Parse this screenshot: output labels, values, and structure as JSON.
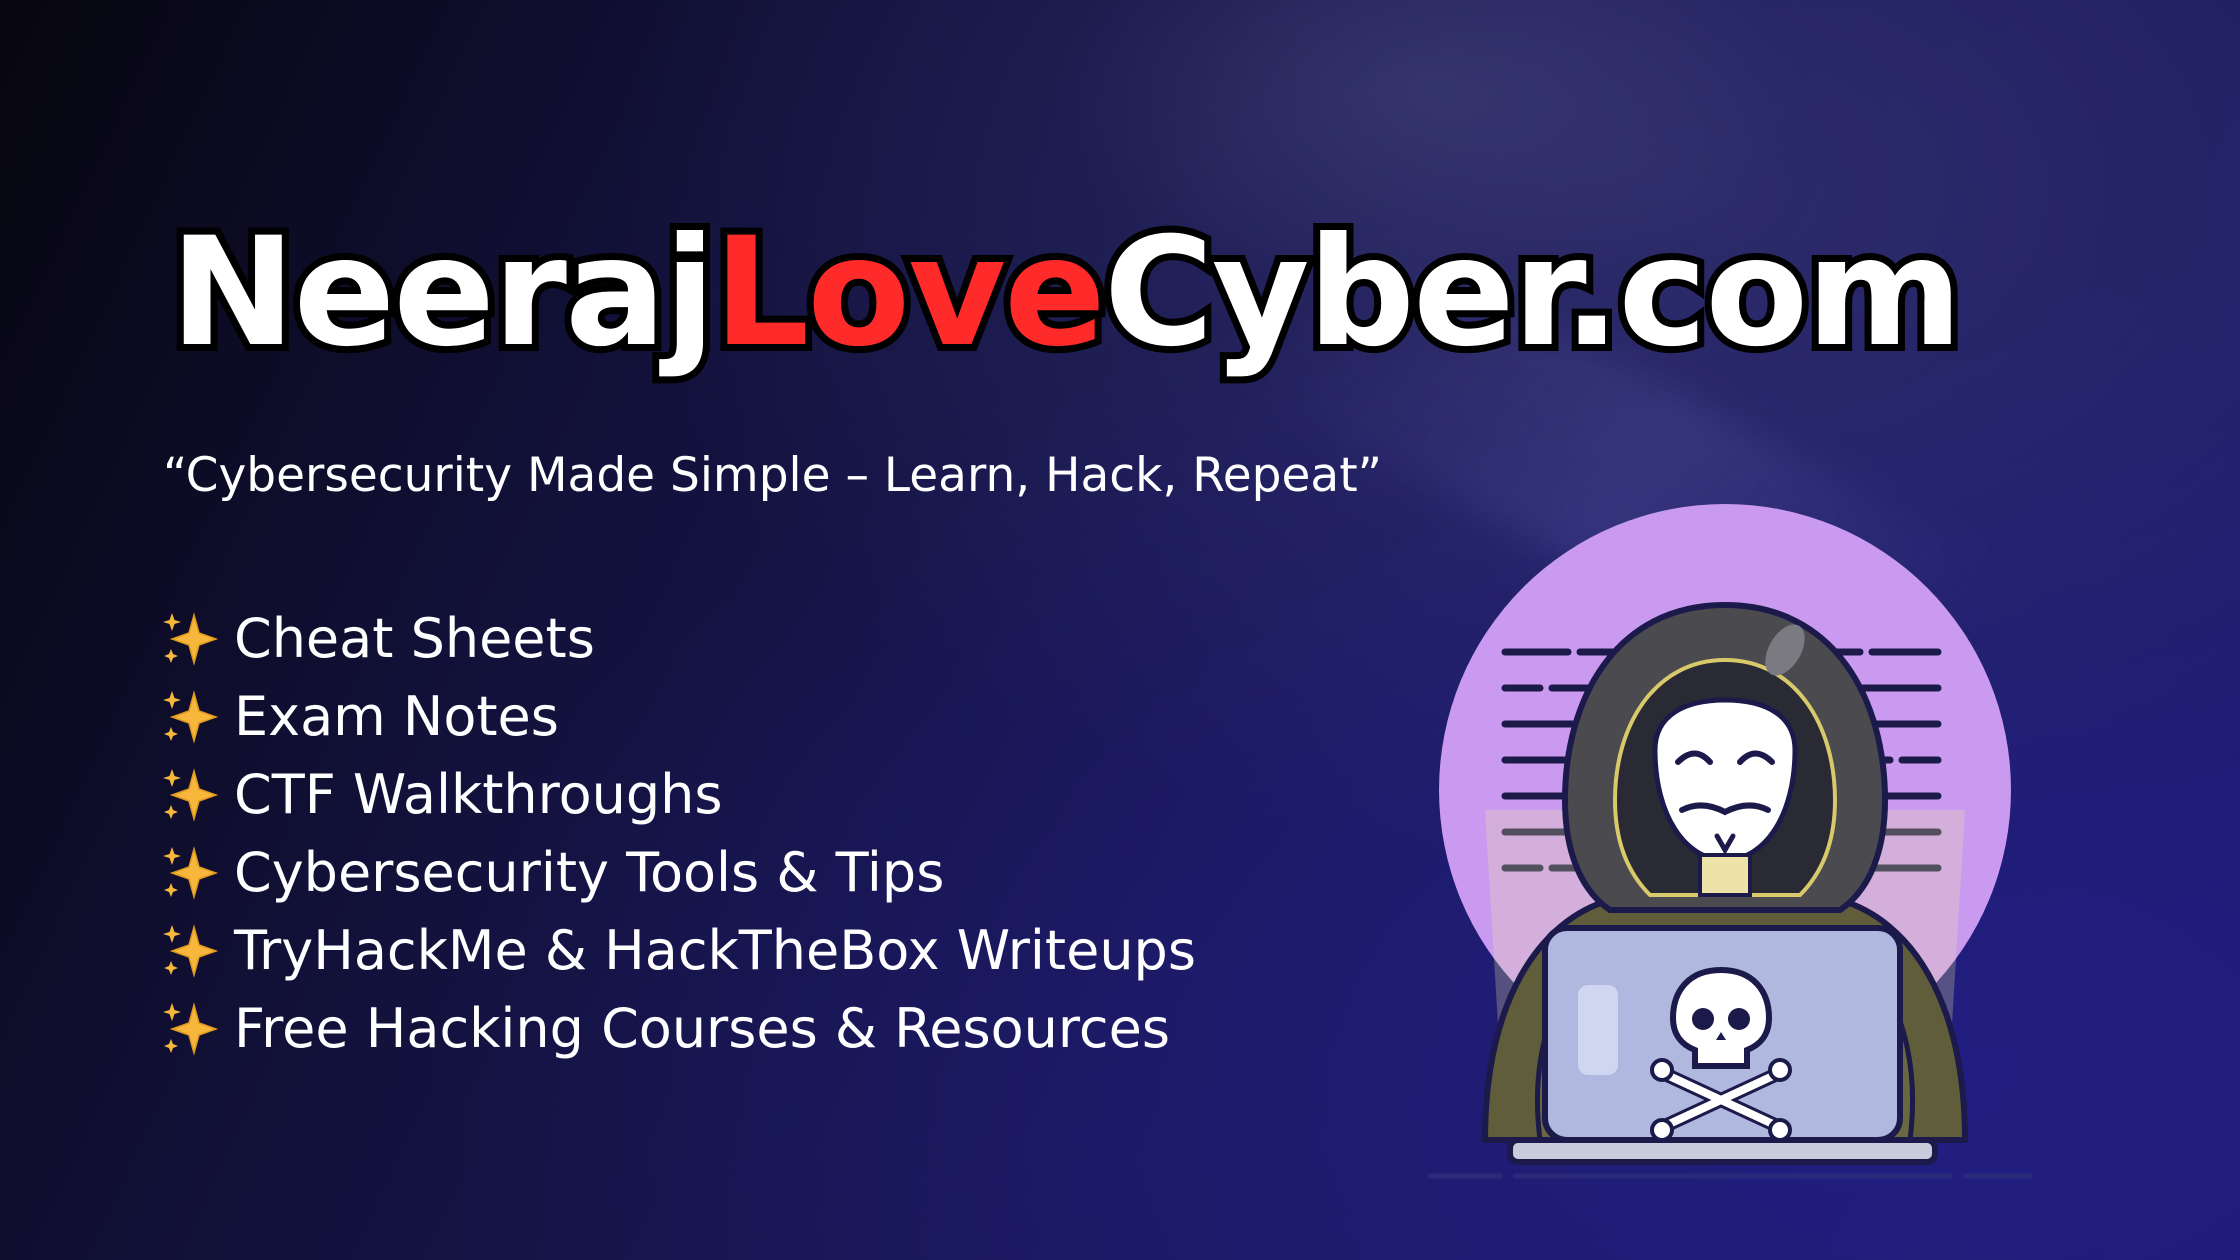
{
  "brand": {
    "part1": "Neeraj",
    "part2": "Love",
    "part3": "Cyber.com"
  },
  "tagline": "“Cybersecurity Made Simple – Learn, Hack, Repeat”",
  "features": [
    "Cheat Sheets",
    "Exam Notes",
    "CTF Walkthroughs",
    "Cybersecurity Tools & Tips",
    "TryHackMe & HackTheBox Writeups",
    "Free Hacking Courses & Resources"
  ],
  "icons": {
    "bullet": "sparkles-icon",
    "illustration": "hooded-hacker-illustration",
    "laptop_logo": "skull-crossbones-icon"
  },
  "colors": {
    "brand_white": "#ffffff",
    "brand_red": "#ff2b2b",
    "circle": "#c99af0",
    "background": "#1a1858"
  }
}
